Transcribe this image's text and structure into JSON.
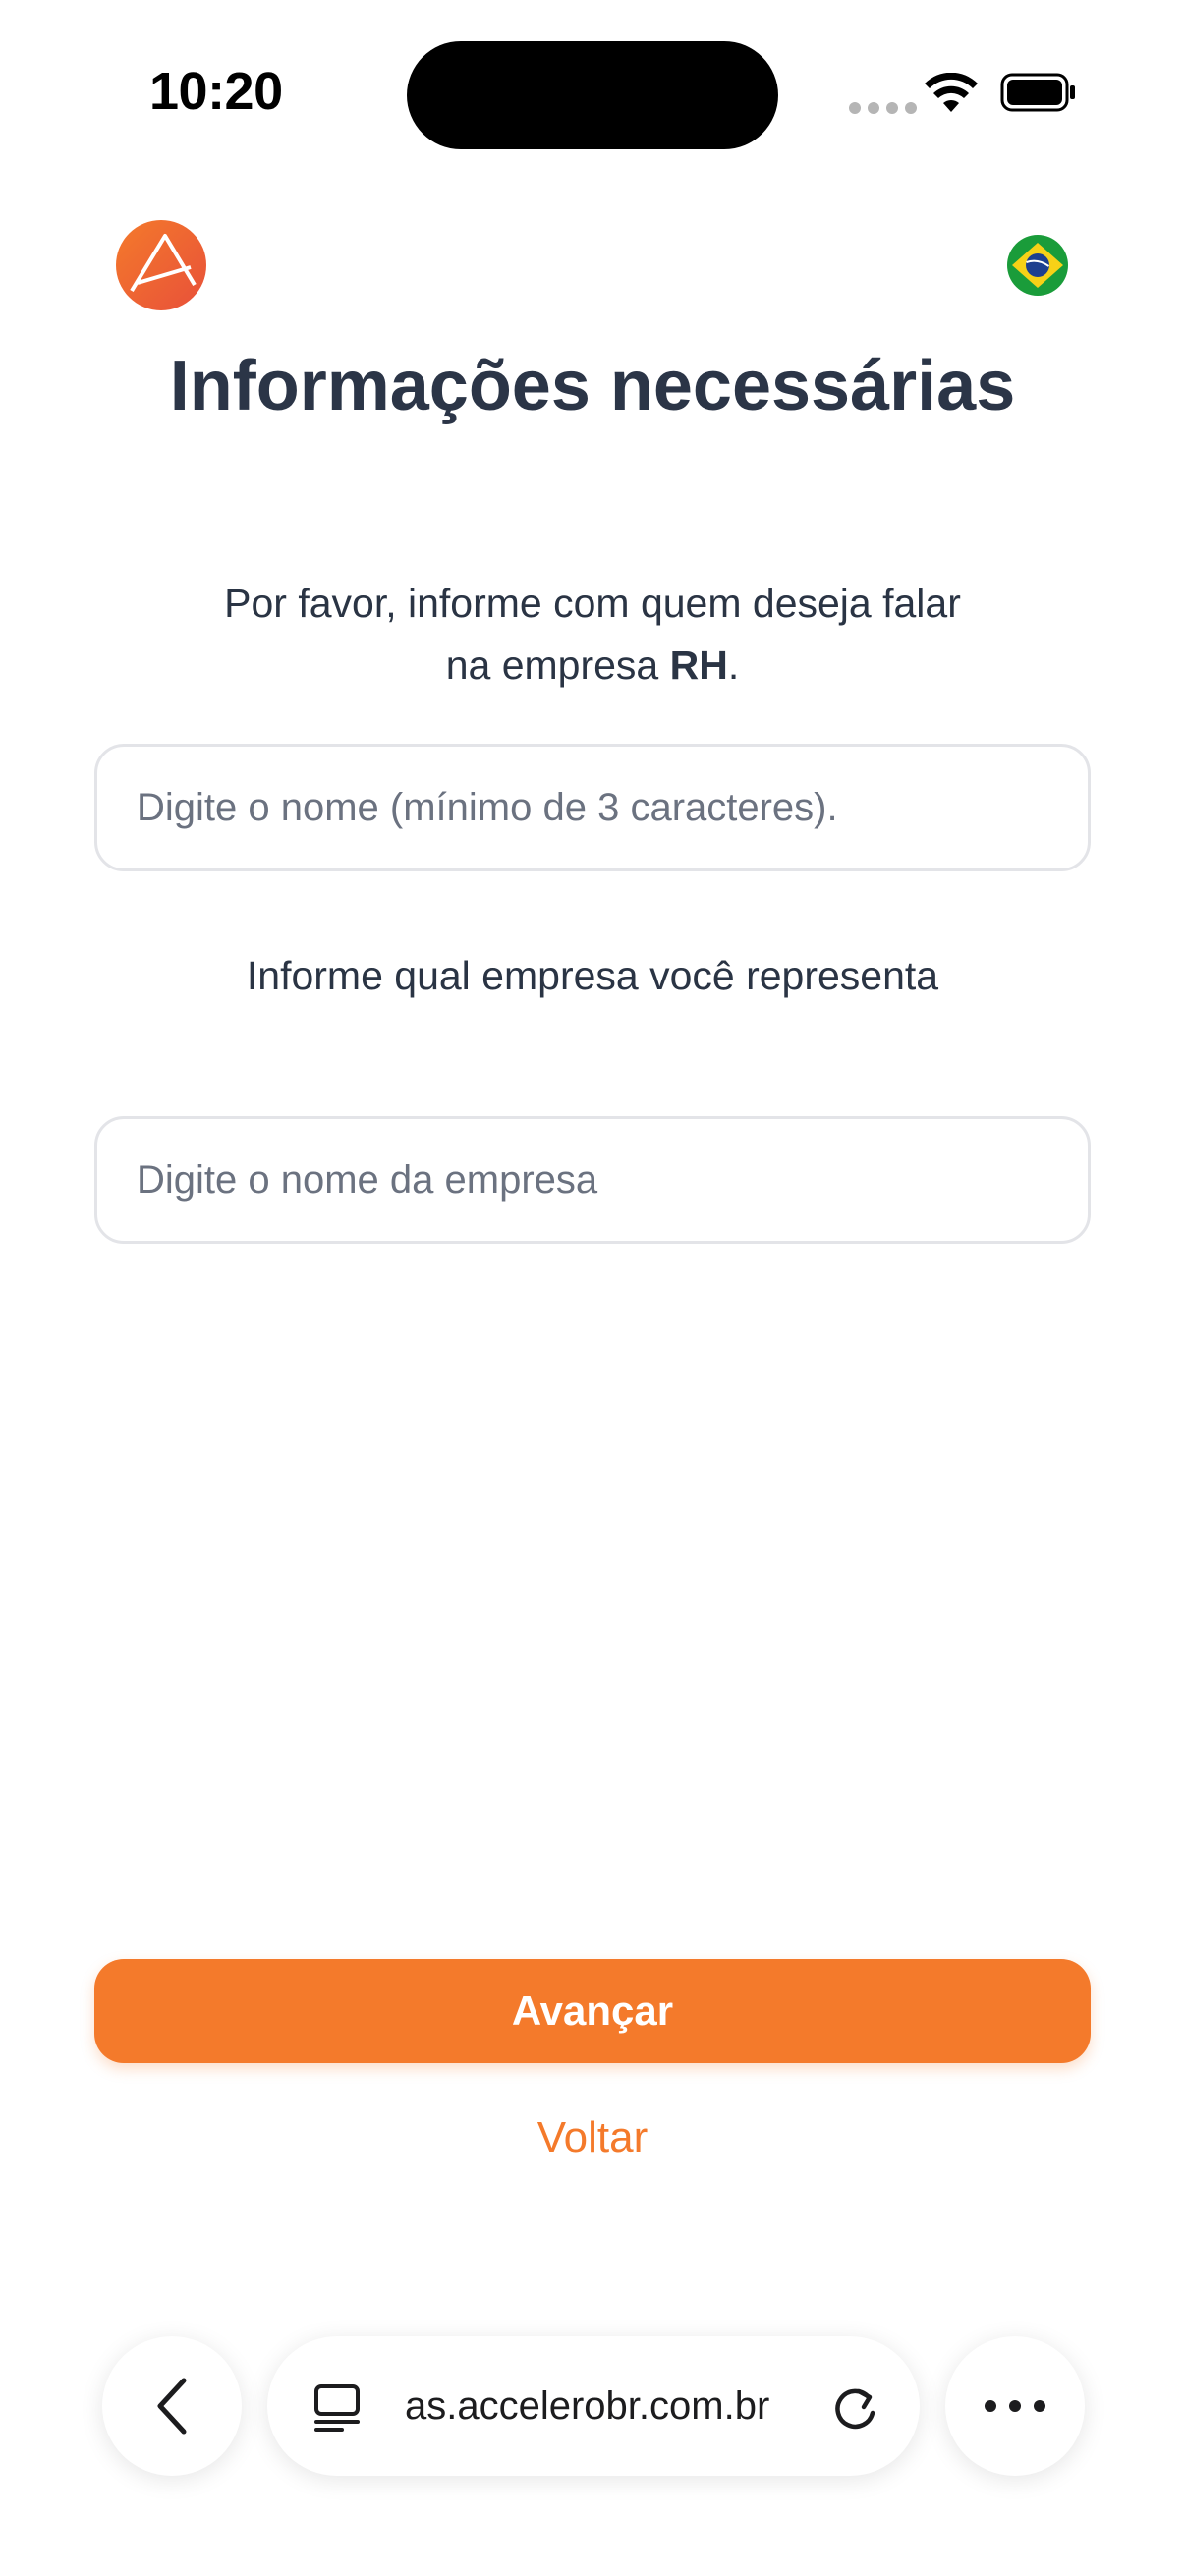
{
  "status_bar": {
    "time": "10:20"
  },
  "header": {
    "title": "Informações necessárias"
  },
  "form": {
    "contact_prompt_prefix": "Por favor, informe com quem deseja falar na empresa",
    "contact_prompt_company": "RH",
    "contact_prompt_suffix": ".",
    "contact_placeholder": "Digite o nome (mínimo de 3 caracteres).",
    "company_prompt": "Informe qual empresa você representa",
    "company_placeholder": "Digite o nome da empresa"
  },
  "actions": {
    "next_label": "Avançar",
    "back_label": "Voltar"
  },
  "browser": {
    "url": "as.accelerobr.com.br"
  },
  "colors": {
    "accent": "#f47a2b",
    "title": "#2b3547",
    "text": "#2a3444"
  },
  "icons": [
    "logo-icon",
    "brazil-flag-icon",
    "wifi-icon",
    "battery-icon",
    "chevron-left-icon",
    "reader-mode-icon",
    "reload-icon",
    "more-icon"
  ]
}
